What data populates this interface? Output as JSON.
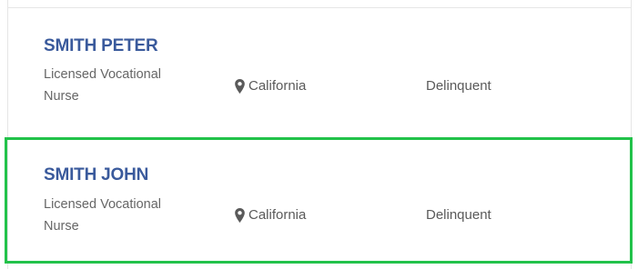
{
  "results": [
    {
      "name": "SMITH PETER",
      "title": "Licensed Vocational Nurse",
      "location": "California",
      "status": "Delinquent",
      "location_icon": "map-pin-icon"
    },
    {
      "name": "SMITH JOHN",
      "title": "Licensed Vocational Nurse",
      "location": "California",
      "status": "Delinquent",
      "location_icon": "map-pin-icon",
      "highlighted": true
    }
  ],
  "colors": {
    "name": "#3a5a9c",
    "text": "#5a5a5a",
    "highlight_border": "#22c24a",
    "border": "#e6e6e6"
  }
}
